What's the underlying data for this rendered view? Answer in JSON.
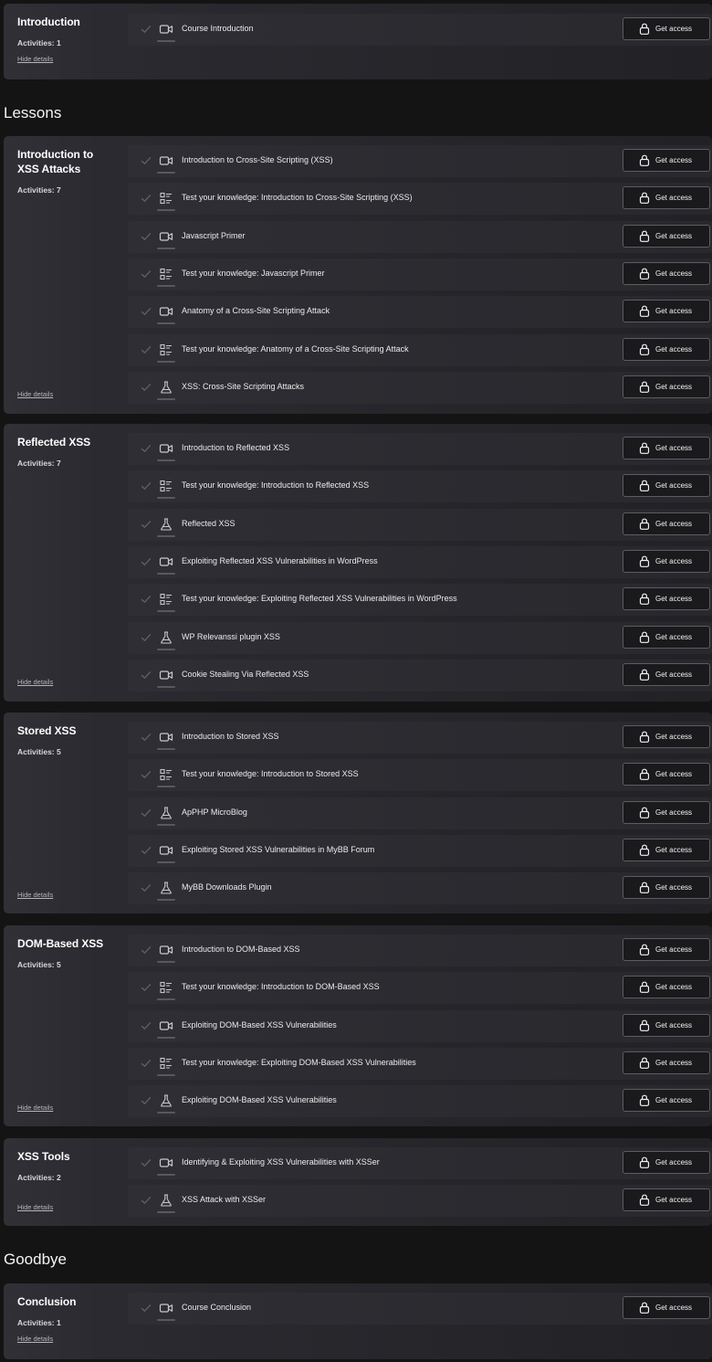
{
  "sections": [
    {
      "heading": "",
      "modules": [
        {
          "title": "Introduction",
          "activities": "Activities: 1",
          "hide": "Hide details",
          "items": [
            {
              "title": "Course Introduction",
              "type": "video-icon",
              "button": "Get access"
            }
          ]
        }
      ]
    },
    {
      "heading": "Lessons",
      "modules": [
        {
          "title": "Introduction to XSS Attacks",
          "activities": "Activities: 7",
          "hide": "Hide details",
          "items": [
            {
              "title": "Introduction to Cross-Site Scripting (XSS)",
              "type": "video-icon",
              "button": "Get access"
            },
            {
              "title": "Test your knowledge: Introduction to Cross-Site Scripting (XSS)",
              "type": "quiz-icon",
              "button": "Get access"
            },
            {
              "title": "Javascript Primer",
              "type": "video-icon",
              "button": "Get access"
            },
            {
              "title": "Test your knowledge: Javascript Primer",
              "type": "quiz-icon",
              "button": "Get access"
            },
            {
              "title": "Anatomy of a Cross-Site Scripting Attack",
              "type": "video-icon",
              "button": "Get access"
            },
            {
              "title": "Test your knowledge: Anatomy of a Cross-Site Scripting Attack",
              "type": "quiz-icon",
              "button": "Get access"
            },
            {
              "title": "XSS: Cross-Site Scripting Attacks",
              "type": "lab-icon",
              "button": "Get access"
            }
          ]
        },
        {
          "title": "Reflected XSS",
          "activities": "Activities: 7",
          "hide": "Hide details",
          "items": [
            {
              "title": "Introduction to Reflected XSS",
              "type": "video-icon",
              "button": "Get access"
            },
            {
              "title": "Test your knowledge: Introduction to Reflected XSS",
              "type": "quiz-icon",
              "button": "Get access"
            },
            {
              "title": "Reflected XSS",
              "type": "lab-icon",
              "button": "Get access"
            },
            {
              "title": "Exploiting Reflected XSS Vulnerabilities in WordPress",
              "type": "video-icon",
              "button": "Get access"
            },
            {
              "title": "Test your knowledge: Exploiting Reflected XSS Vulnerabilities in WordPress",
              "type": "quiz-icon",
              "button": "Get access"
            },
            {
              "title": "WP Relevanssi plugin XSS",
              "type": "lab-icon",
              "button": "Get access"
            },
            {
              "title": "Cookie Stealing Via Reflected XSS",
              "type": "video-icon",
              "button": "Get access"
            }
          ]
        },
        {
          "title": "Stored XSS",
          "activities": "Activities: 5",
          "hide": "Hide details",
          "items": [
            {
              "title": "Introduction to Stored XSS",
              "type": "video-icon",
              "button": "Get access"
            },
            {
              "title": "Test your knowledge: Introduction to Stored XSS",
              "type": "quiz-icon",
              "button": "Get access"
            },
            {
              "title": "ApPHP MicroBlog",
              "type": "lab-icon",
              "button": "Get access"
            },
            {
              "title": "Exploiting Stored XSS Vulnerabilities in MyBB Forum",
              "type": "video-icon",
              "button": "Get access"
            },
            {
              "title": "MyBB Downloads Plugin",
              "type": "lab-icon",
              "button": "Get access"
            }
          ]
        },
        {
          "title": "DOM-Based XSS",
          "activities": "Activities: 5",
          "hide": "Hide details",
          "items": [
            {
              "title": "Introduction to DOM-Based XSS",
              "type": "video-icon",
              "button": "Get access"
            },
            {
              "title": "Test your knowledge: Introduction to DOM-Based XSS",
              "type": "quiz-icon",
              "button": "Get access"
            },
            {
              "title": "Exploiting DOM-Based XSS Vulnerabilities",
              "type": "video-icon",
              "button": "Get access"
            },
            {
              "title": "Test your knowledge: Exploiting DOM-Based XSS Vulnerabilities",
              "type": "quiz-icon",
              "button": "Get access"
            },
            {
              "title": "Exploiting DOM-Based XSS Vulnerabilities",
              "type": "lab-icon",
              "button": "Get access"
            }
          ]
        },
        {
          "title": "XSS Tools",
          "activities": "Activities: 2",
          "hide": "Hide details",
          "items": [
            {
              "title": "Identifying & Exploiting XSS Vulnerabilities with XSSer",
              "type": "video-icon",
              "button": "Get access"
            },
            {
              "title": "XSS Attack with XSSer",
              "type": "lab-icon",
              "button": "Get access"
            }
          ]
        }
      ]
    },
    {
      "heading": "Goodbye",
      "modules": [
        {
          "title": "Conclusion",
          "activities": "Activities: 1",
          "hide": "Hide details",
          "items": [
            {
              "title": "Course Conclusion",
              "type": "video-icon",
              "button": "Get access"
            }
          ]
        }
      ]
    }
  ],
  "icons": {
    "check": "check-icon",
    "lock": "lock-icon"
  },
  "colors": {
    "background": "#141414",
    "card": "#2a2a30",
    "row": "#2e2e34",
    "button_border": "#5c5c62"
  }
}
